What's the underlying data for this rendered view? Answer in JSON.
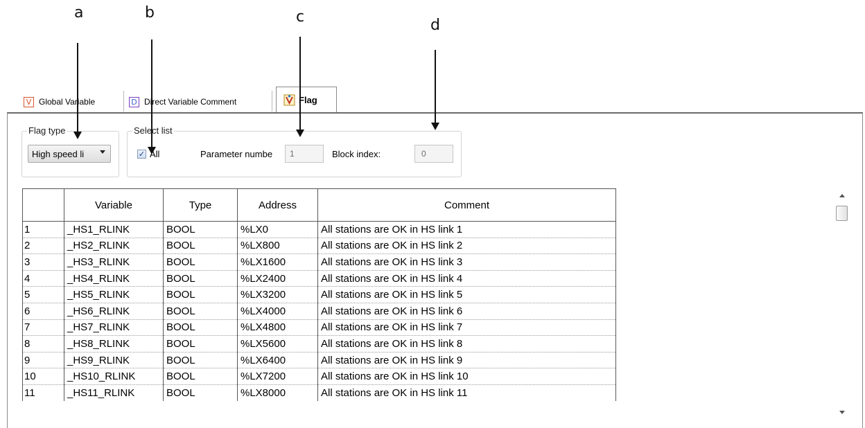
{
  "callouts": {
    "a": "a",
    "b": "b",
    "c": "c",
    "d": "d"
  },
  "tabs": [
    {
      "icon": "V",
      "label": "Global Variable",
      "icon_color": "#d9532b"
    },
    {
      "icon": "D",
      "label": "Direct Variable Comment",
      "icon_color": "#7b3fc4"
    },
    {
      "icon": "V",
      "label": "Flag",
      "active": true
    }
  ],
  "flag_type": {
    "title": "Flag type",
    "selected": "High speed li"
  },
  "select_list": {
    "title": "Select list",
    "all_label": "All",
    "all_checked": true,
    "param_label": "Parameter numbe",
    "param_value": "1",
    "block_label": "Block index:",
    "block_value": "0"
  },
  "table": {
    "columns": [
      "",
      "Variable",
      "Type",
      "Address",
      "Comment"
    ],
    "rows": [
      [
        "1",
        "_HS1_RLINK",
        "BOOL",
        "%LX0",
        "All stations are OK in HS link 1"
      ],
      [
        "2",
        "_HS2_RLINK",
        "BOOL",
        "%LX800",
        "All stations are OK in HS link 2"
      ],
      [
        "3",
        "_HS3_RLINK",
        "BOOL",
        "%LX1600",
        "All stations are OK in HS link 3"
      ],
      [
        "4",
        "_HS4_RLINK",
        "BOOL",
        "%LX2400",
        "All stations are OK in HS link 4"
      ],
      [
        "5",
        "_HS5_RLINK",
        "BOOL",
        "%LX3200",
        "All stations are OK in HS link 5"
      ],
      [
        "6",
        "_HS6_RLINK",
        "BOOL",
        "%LX4000",
        "All stations are OK in HS link 6"
      ],
      [
        "7",
        "_HS7_RLINK",
        "BOOL",
        "%LX4800",
        "All stations are OK in HS link 7"
      ],
      [
        "8",
        "_HS8_RLINK",
        "BOOL",
        "%LX5600",
        "All stations are OK in HS link 8"
      ],
      [
        "9",
        "_HS9_RLINK",
        "BOOL",
        "%LX6400",
        "All stations are OK in HS link 9"
      ],
      [
        "10",
        "_HS10_RLINK",
        "BOOL",
        "%LX7200",
        "All stations are OK in HS link 10"
      ],
      [
        "11",
        "_HS11_RLINK",
        "BOOL",
        "%LX8000",
        "All stations are OK in HS link 11"
      ]
    ]
  }
}
